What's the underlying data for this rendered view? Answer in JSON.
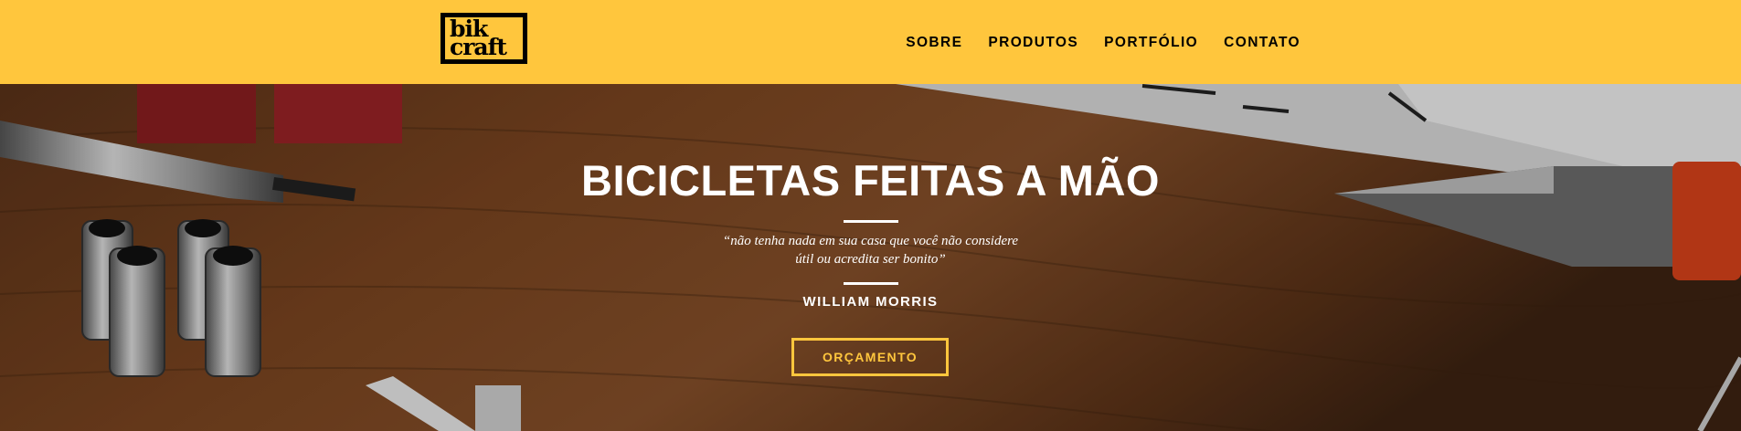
{
  "header": {
    "logo_line1": "bik",
    "logo_line2": "craft",
    "nav": [
      "SOBRE",
      "PRODUTOS",
      "PORTFÓLIO",
      "CONTATO"
    ]
  },
  "hero": {
    "title": "BICICLETAS FEITAS A MÃO",
    "quote_line1": "“não tenha nada em sua casa que você não considere",
    "quote_line2": "útil ou acredita ser bonito”",
    "author": "WILLIAM MORRIS",
    "button_label": "ORÇAMENTO"
  },
  "colors": {
    "accent": "#FFC63D",
    "text_dark": "#000000",
    "text_light": "#FFFFFF"
  }
}
